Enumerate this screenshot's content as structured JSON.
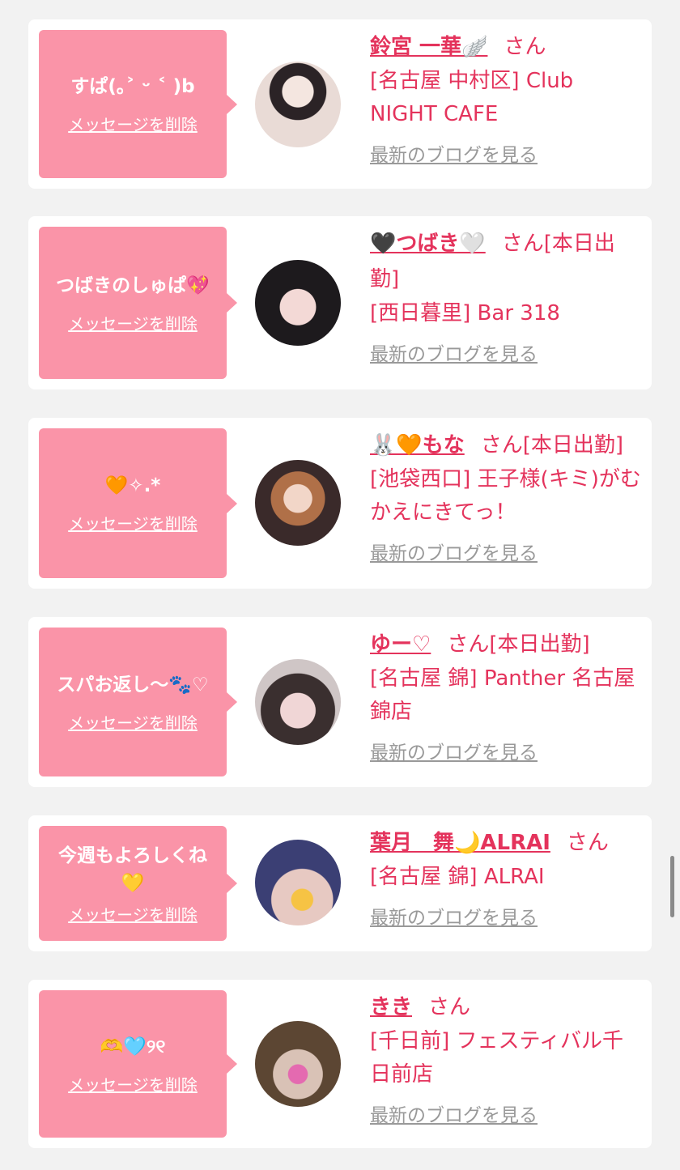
{
  "delete_label": "メッセージを削除",
  "blog_label": "最新のブログを見る",
  "colors": {
    "bubble": "#fa94a8",
    "accent": "#e4335c",
    "link_gray": "#999999",
    "card": "#ffffff",
    "background": "#f2f2f2"
  },
  "cards": [
    {
      "message": "すぱ(｡˃ ᵕ ˂ )b",
      "name": "鈴宮 一華🪽",
      "san": "さん",
      "shop": "[名古屋 中村区] Club NIGHT CAFE",
      "avatar_icon": "profile-photo"
    },
    {
      "message": "つばきのしゅぱ💖",
      "name": "🖤つばき🤍",
      "san": "さん[本日出勤]",
      "shop": "[西日暮里] Bar 318",
      "avatar_icon": "profile-photo"
    },
    {
      "message": "🧡✧.*",
      "name": "🐰🧡もな",
      "san": "さん[本日出勤]",
      "shop": "[池袋西口] 王子様(キミ)がむかえにきてっ！",
      "avatar_icon": "profile-photo"
    },
    {
      "message": "スパお返し〜🐾♡",
      "name": "ゆー♡",
      "san": "さん[本日出勤]",
      "shop": "[名古屋 錦] Panther 名古屋錦店",
      "avatar_icon": "profile-photo"
    },
    {
      "message": "今週もよろしくね💛",
      "name": "葉月　舞🌙ALRAI",
      "san": "さん",
      "shop": "[名古屋 錦] ALRAI",
      "avatar_icon": "profile-photo"
    },
    {
      "message": "🫶🩵୨୧",
      "name": "きき",
      "san": "さん",
      "shop": "[千日前] フェスティバル千日前店",
      "avatar_icon": "profile-photo"
    }
  ]
}
